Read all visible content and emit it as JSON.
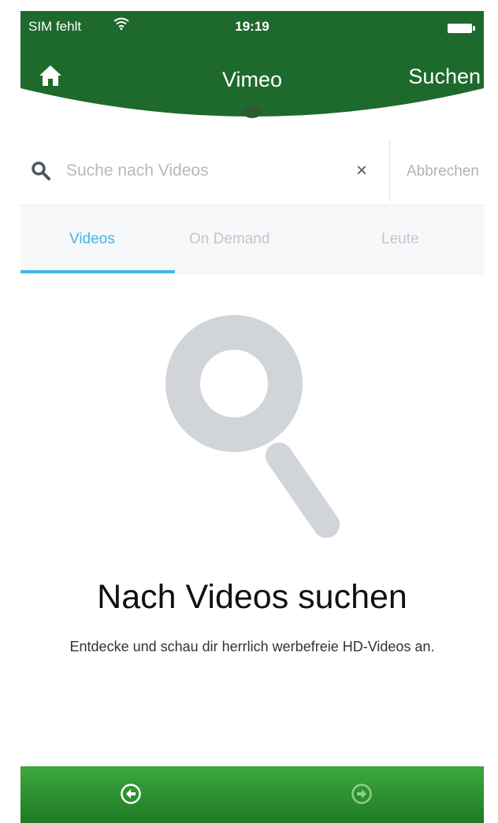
{
  "status_bar": {
    "carrier": "SIM fehlt",
    "time": "19:19"
  },
  "navbar": {
    "home_icon": "home-icon",
    "title": "Vimeo",
    "search_action": "Suchen"
  },
  "search": {
    "placeholder": "Suche nach Videos",
    "clear_symbol": "×",
    "cancel_label": "Abbrechen"
  },
  "tabs": [
    {
      "label": "Videos",
      "active": true
    },
    {
      "label": "On Demand",
      "active": false
    },
    {
      "label": "Leute",
      "active": false
    }
  ],
  "empty_state": {
    "heading": "Nach Videos suchen",
    "description": "Entdecke und schau dir herrlich werbefreie HD-Videos an."
  },
  "bottom_bar": {
    "back_icon": "back-arrow-icon",
    "forward_icon": "forward-arrow-icon"
  },
  "colors": {
    "header_green": "#1e6a2c",
    "accent_blue": "#43b6e8",
    "bottom_green": "#2e8f33",
    "icon_gray": "#d1d4d9"
  }
}
